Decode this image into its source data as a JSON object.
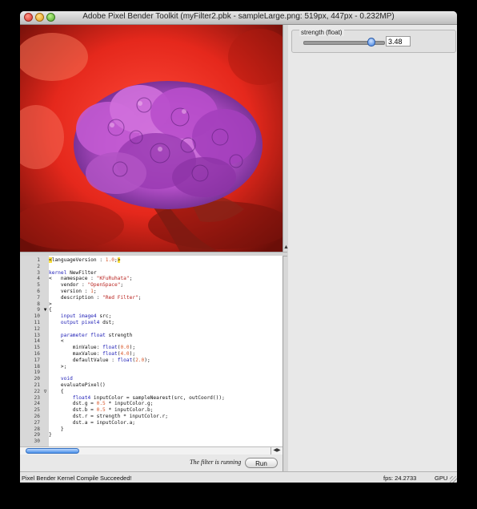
{
  "window": {
    "title": "Adobe Pixel Bender Toolkit (myFilter2.pbk - sampleLarge.png: 519px, 447px - 0.232MP)"
  },
  "parameters": {
    "strength": {
      "label": "strength (float)",
      "value": "3.48",
      "slider_fraction": 0.84
    }
  },
  "editor": {
    "lines": [
      {
        "n": "1",
        "text": "<languageVersion : 1.0;>"
      },
      {
        "n": "2",
        "text": ""
      },
      {
        "n": "3",
        "text": "kernel NewFilter"
      },
      {
        "n": "4",
        "text": "<   namespace : \"KFuRuhata\";"
      },
      {
        "n": "5",
        "text": "    vendor : \"OpenSpace\";"
      },
      {
        "n": "6",
        "text": "    version : 1;"
      },
      {
        "n": "7",
        "text": "    description : \"Red Filter\";"
      },
      {
        "n": "8",
        "text": ">"
      },
      {
        "n": "9",
        "text": "{"
      },
      {
        "n": "10",
        "text": "    input image4 src;"
      },
      {
        "n": "11",
        "text": "    output pixel4 dst;"
      },
      {
        "n": "12",
        "text": ""
      },
      {
        "n": "13",
        "text": "    parameter float strength"
      },
      {
        "n": "14",
        "text": "    <"
      },
      {
        "n": "15",
        "text": "        minValue: float(0.0);"
      },
      {
        "n": "16",
        "text": "        maxValue: float(4.0);"
      },
      {
        "n": "17",
        "text": "        defaultValue : float(2.0);"
      },
      {
        "n": "18",
        "text": "    >;"
      },
      {
        "n": "19",
        "text": ""
      },
      {
        "n": "20",
        "text": "    void"
      },
      {
        "n": "21",
        "text": "    evaluatePixel()"
      },
      {
        "n": "22",
        "text": "    {"
      },
      {
        "n": "23",
        "text": "        float4 inputColor = sampleNearest(src, outCoord());"
      },
      {
        "n": "24",
        "text": "        dst.g = 0.5 * inputColor.g;"
      },
      {
        "n": "25",
        "text": "        dst.b = 0.5 * inputColor.b;"
      },
      {
        "n": "26",
        "text": "        dst.r = strength * inputColor.r;"
      },
      {
        "n": "27",
        "text": "        dst.a = inputColor.a;"
      },
      {
        "n": "28",
        "text": "    }"
      },
      {
        "n": "29",
        "text": "}"
      },
      {
        "n": "30",
        "text": ""
      }
    ]
  },
  "runbar": {
    "status": "The filter is running",
    "run_label": "Run"
  },
  "statusbar": {
    "message": "Pixel Bender Kernel Compile Succeeded!",
    "fps": "fps: 24.2733",
    "mode": "GPU"
  },
  "colors": {
    "keyword": "#2323b8",
    "string": "#b8231f",
    "number": "#d9572a",
    "bracket_highlight": "#ffe23f"
  }
}
